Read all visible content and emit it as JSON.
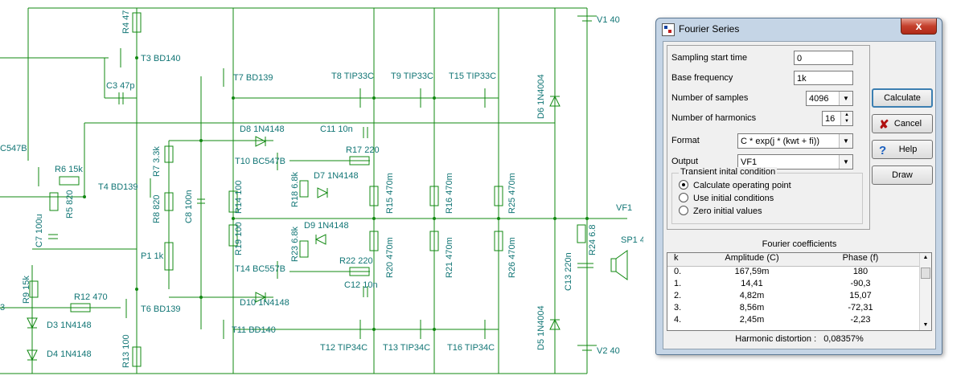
{
  "schematic": {
    "labels": {
      "r4": "R4 47",
      "t3": "T3 BD140",
      "c3": "C3 47p",
      "t7": "T7 BD139",
      "t8": "T8 TIP33C",
      "t9": "T9 TIP33C",
      "t15": "T15 TIP33C",
      "v1": "V1 40",
      "v2": "V2 40",
      "d6": "D6 1N4004",
      "d5": "D5 1N4004",
      "t_left": "C547B",
      "r6": "R6 15k",
      "r5": "R5 820",
      "c7": "C7 100u",
      "t4": "T4 BD139",
      "r7": "R7 3.3k",
      "r8": "R8 820",
      "c8": "C8 100n",
      "p1": "P1 1k",
      "d8": "D8 1N4148",
      "c11": "C11 10n",
      "r17": "R17 220",
      "t10": "T10 BC547B",
      "r18": "R18 6.8k",
      "d7": "D7 1N4148",
      "r14": "R14 100",
      "r15": "R15 470m",
      "r16": "R16 470m",
      "r25": "R25 470m",
      "vf1": "VF1",
      "r24": "R24 6.8",
      "sp1": "SP1 4",
      "c13": "C13 220n",
      "r19": "R19 100",
      "d9": "D9 1N4148",
      "r23": "R23 6.8k",
      "r22": "R22 220",
      "r20": "R20 470m",
      "r21": "R21 470m",
      "r26": "R26 470m",
      "t14": "T14 BC557B",
      "c12": "C12 10n",
      "d10": "D10 1N4148",
      "r9": "R9 15k",
      "r12": "R12 470",
      "t6": "T6 BD139",
      "d3": "D3 1N4148",
      "d4": "D4 1N4148",
      "r13": "R13 100",
      "t11": "T11 BD140",
      "t12": "T12 TIP34C",
      "t13": "T13 TIP34C",
      "t16": "T16 TIP34C",
      "t_left2": "3"
    }
  },
  "dialog": {
    "title": "Fourier Series",
    "close_label": "x",
    "params": {
      "sampling_start_label": "Sampling start time",
      "sampling_start_value": "0",
      "base_freq_label": "Base frequency",
      "base_freq_value": "1k",
      "num_samples_label": "Number of samples",
      "num_samples_value": "4096",
      "num_harmonics_label": "Number of harmonics",
      "num_harmonics_value": "16",
      "format_label": "Format",
      "format_value": "C * exp(j * (kwt + fi))",
      "output_label": "Output",
      "output_value": "VF1"
    },
    "transient": {
      "legend": "Transient inital condition",
      "options": [
        "Calculate operating point",
        "Use initial conditions",
        "Zero initial values"
      ],
      "selected_index": 0
    },
    "buttons": {
      "calculate": "Calculate",
      "cancel": "Cancel",
      "help": "Help",
      "draw": "Draw"
    },
    "coefficients": {
      "title": "Fourier coefficients",
      "headers": [
        "k",
        "Amplitude (C)",
        "Phase (f)"
      ],
      "rows": [
        [
          "0.",
          "167,59m",
          "180"
        ],
        [
          "1.",
          "14,41",
          "-90,3"
        ],
        [
          "2.",
          "4,82m",
          "15,07"
        ],
        [
          "3.",
          "8,56m",
          "-72,31"
        ],
        [
          "4.",
          "2,45m",
          "-2,23"
        ]
      ]
    },
    "distortion_label": "Harmonic distortion :",
    "distortion_value": "0,08357%"
  }
}
